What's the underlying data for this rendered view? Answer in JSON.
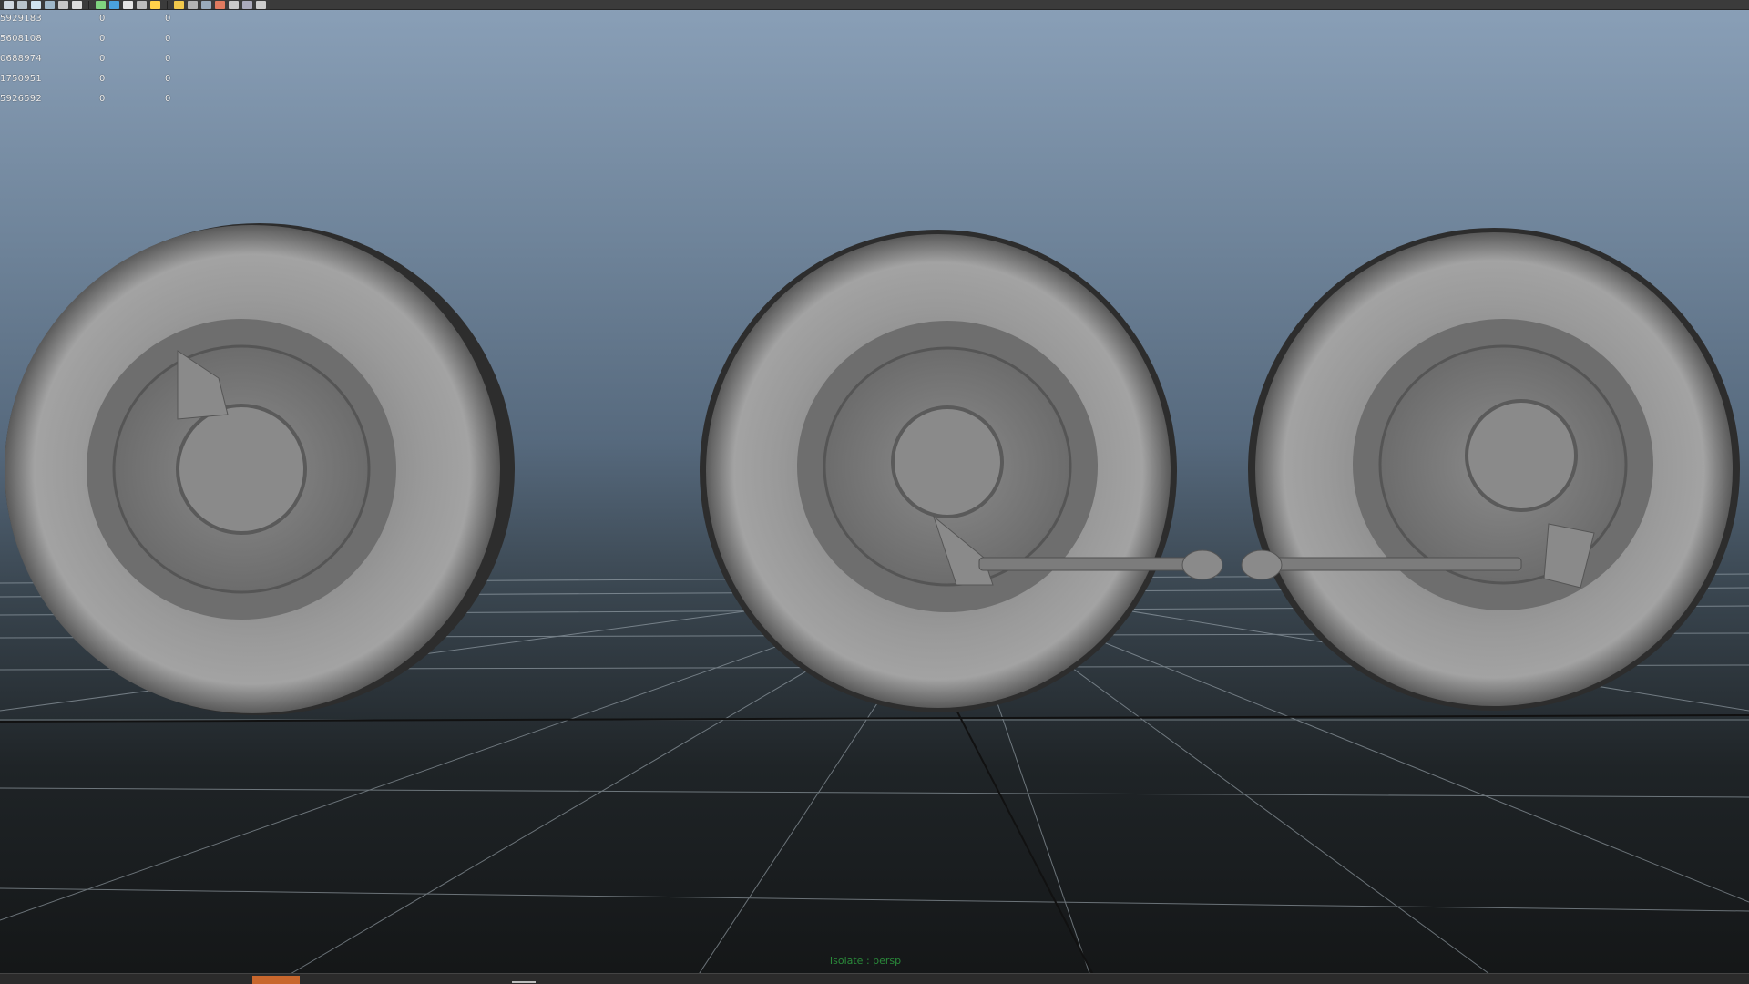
{
  "viewport": {
    "camera_label": "Isolate : persp",
    "hud_rows": [
      {
        "id": "5929183",
        "v1": "0",
        "v2": "0"
      },
      {
        "id": "5608108",
        "v1": "0",
        "v2": "0"
      },
      {
        "id": "0688974",
        "v1": "0",
        "v2": "0"
      },
      {
        "id": "1750951",
        "v1": "0",
        "v2": "0"
      },
      {
        "id": "5926592",
        "v1": "0",
        "v2": "0"
      }
    ]
  },
  "toolbar": {
    "icons": [
      "select-tool-icon",
      "lasso-tool-icon",
      "camera-icon",
      "grid-icon",
      "view-icon",
      "frame-icon",
      "isolate-icon",
      "render-icon",
      "wireframe-icon",
      "smooth-shade-icon",
      "textured-icon",
      "lights-icon",
      "shadows-icon",
      "ao-icon",
      "motion-blur-icon",
      "hud-icon",
      "xray-icon",
      "xray-joints-icon"
    ]
  },
  "colors": {
    "tire": "#8c8c8c",
    "grid": "#9aa6ae",
    "camera_label": "#2a8a3a",
    "timeline_marker": "#c8672d"
  }
}
